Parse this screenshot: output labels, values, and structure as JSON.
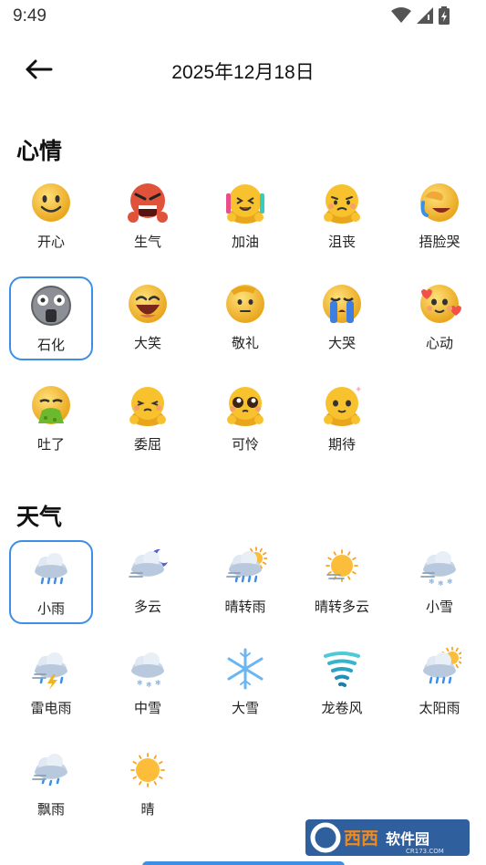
{
  "status": {
    "time": "9:49"
  },
  "header": {
    "title": "2025年12月18日"
  },
  "mood": {
    "title": "心情",
    "items": [
      {
        "label": "开心",
        "icon": "smile-face-icon"
      },
      {
        "label": "生气",
        "icon": "angry-face-icon"
      },
      {
        "label": "加油",
        "icon": "cheer-face-icon"
      },
      {
        "label": "沮丧",
        "icon": "sad-face-icon"
      },
      {
        "label": "捂脸哭",
        "icon": "facepalm-cry-icon"
      },
      {
        "label": "石化",
        "icon": "petrified-face-icon",
        "selected": true
      },
      {
        "label": "大笑",
        "icon": "laugh-face-icon"
      },
      {
        "label": "敬礼",
        "icon": "salute-face-icon"
      },
      {
        "label": "大哭",
        "icon": "crying-face-icon"
      },
      {
        "label": "心动",
        "icon": "heart-face-icon"
      },
      {
        "label": "吐了",
        "icon": "vomit-face-icon"
      },
      {
        "label": "委屈",
        "icon": "aggrieved-face-icon"
      },
      {
        "label": "可怜",
        "icon": "pitiful-face-icon"
      },
      {
        "label": "期待",
        "icon": "expecting-face-icon"
      }
    ]
  },
  "weather": {
    "title": "天气",
    "items": [
      {
        "label": "小雨",
        "icon": "light-rain-icon",
        "selected": true
      },
      {
        "label": "多云",
        "icon": "cloudy-night-icon"
      },
      {
        "label": "晴转雨",
        "icon": "sun-to-rain-icon"
      },
      {
        "label": "晴转多云",
        "icon": "sun-to-cloudy-icon"
      },
      {
        "label": "小雪",
        "icon": "light-snow-icon"
      },
      {
        "label": "雷电雨",
        "icon": "thunderstorm-icon"
      },
      {
        "label": "中雪",
        "icon": "moderate-snow-icon"
      },
      {
        "label": "大雪",
        "icon": "snowflake-icon"
      },
      {
        "label": "龙卷风",
        "icon": "tornado-icon"
      },
      {
        "label": "太阳雨",
        "icon": "sun-shower-icon"
      },
      {
        "label": "飘雨",
        "icon": "drizzle-icon"
      },
      {
        "label": "晴",
        "icon": "sunny-icon"
      }
    ]
  },
  "watermark": {
    "text": "西西软件园",
    "sub": "CR173.COM"
  },
  "colors": {
    "accent": "#3d8fe6",
    "emoji": "#f6c12c"
  }
}
